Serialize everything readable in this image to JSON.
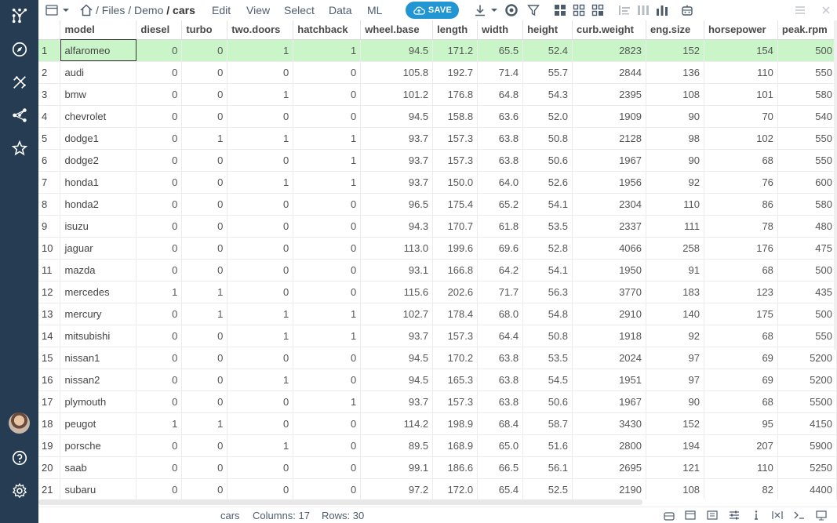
{
  "toolbar": {
    "breadcrumb": {
      "root": "Files",
      "sep": "/",
      "folder": "Demo",
      "current": "cars"
    },
    "menu": [
      "Edit",
      "View",
      "Select",
      "Data",
      "ML"
    ],
    "save_label": "SAVE"
  },
  "table": {
    "columns": [
      "model",
      "diesel",
      "turbo",
      "two.doors",
      "hatchback",
      "wheel.base",
      "length",
      "width",
      "height",
      "curb.weight",
      "eng.size",
      "horsepower",
      "peak.rpm"
    ],
    "rows": [
      [
        "1",
        "alfaromeo",
        "0",
        "0",
        "1",
        "1",
        "94.5",
        "171.2",
        "65.5",
        "52.4",
        "2823",
        "152",
        "154",
        "500"
      ],
      [
        "2",
        "audi",
        "0",
        "0",
        "0",
        "0",
        "105.8",
        "192.7",
        "71.4",
        "55.7",
        "2844",
        "136",
        "110",
        "550"
      ],
      [
        "3",
        "bmw",
        "0",
        "0",
        "1",
        "0",
        "101.2",
        "176.8",
        "64.8",
        "54.3",
        "2395",
        "108",
        "101",
        "580"
      ],
      [
        "4",
        "chevrolet",
        "0",
        "0",
        "0",
        "0",
        "94.5",
        "158.8",
        "63.6",
        "52.0",
        "1909",
        "90",
        "70",
        "540"
      ],
      [
        "5",
        "dodge1",
        "0",
        "1",
        "1",
        "1",
        "93.7",
        "157.3",
        "63.8",
        "50.8",
        "2128",
        "98",
        "102",
        "550"
      ],
      [
        "6",
        "dodge2",
        "0",
        "0",
        "0",
        "1",
        "93.7",
        "157.3",
        "63.8",
        "50.6",
        "1967",
        "90",
        "68",
        "550"
      ],
      [
        "7",
        "honda1",
        "0",
        "0",
        "1",
        "1",
        "93.7",
        "150.0",
        "64.0",
        "52.6",
        "1956",
        "92",
        "76",
        "600"
      ],
      [
        "8",
        "honda2",
        "0",
        "0",
        "0",
        "0",
        "96.5",
        "175.4",
        "65.2",
        "54.1",
        "2304",
        "110",
        "86",
        "580"
      ],
      [
        "9",
        "isuzu",
        "0",
        "0",
        "0",
        "0",
        "94.3",
        "170.7",
        "61.8",
        "53.5",
        "2337",
        "111",
        "78",
        "480"
      ],
      [
        "10",
        "jaguar",
        "0",
        "0",
        "0",
        "0",
        "113.0",
        "199.6",
        "69.6",
        "52.8",
        "4066",
        "258",
        "176",
        "475"
      ],
      [
        "11",
        "mazda",
        "0",
        "0",
        "0",
        "0",
        "93.1",
        "166.8",
        "64.2",
        "54.1",
        "1950",
        "91",
        "68",
        "500"
      ],
      [
        "12",
        "mercedes",
        "1",
        "1",
        "0",
        "0",
        "115.6",
        "202.6",
        "71.7",
        "56.3",
        "3770",
        "183",
        "123",
        "435"
      ],
      [
        "13",
        "mercury",
        "0",
        "1",
        "1",
        "1",
        "102.7",
        "178.4",
        "68.0",
        "54.8",
        "2910",
        "140",
        "175",
        "500"
      ],
      [
        "14",
        "mitsubishi",
        "0",
        "0",
        "1",
        "1",
        "93.7",
        "157.3",
        "64.4",
        "50.8",
        "1918",
        "92",
        "68",
        "550"
      ],
      [
        "15",
        "nissan1",
        "0",
        "0",
        "0",
        "0",
        "94.5",
        "170.2",
        "63.8",
        "53.5",
        "2024",
        "97",
        "69",
        "5200"
      ],
      [
        "16",
        "nissan2",
        "0",
        "0",
        "1",
        "0",
        "94.5",
        "165.3",
        "63.8",
        "54.5",
        "1951",
        "97",
        "69",
        "5200"
      ],
      [
        "17",
        "plymouth",
        "0",
        "0",
        "0",
        "1",
        "93.7",
        "157.3",
        "63.8",
        "50.6",
        "1967",
        "90",
        "68",
        "5500"
      ],
      [
        "18",
        "peugot",
        "1",
        "1",
        "0",
        "0",
        "114.2",
        "198.9",
        "68.4",
        "58.7",
        "3430",
        "152",
        "95",
        "4150"
      ],
      [
        "19",
        "porsche",
        "0",
        "0",
        "1",
        "0",
        "89.5",
        "168.9",
        "65.0",
        "51.6",
        "2800",
        "194",
        "207",
        "5900"
      ],
      [
        "20",
        "saab",
        "0",
        "0",
        "0",
        "0",
        "99.1",
        "186.6",
        "66.5",
        "56.1",
        "2695",
        "121",
        "110",
        "5250"
      ],
      [
        "21",
        "subaru",
        "0",
        "0",
        "0",
        "0",
        "97.2",
        "172.0",
        "65.4",
        "52.5",
        "2190",
        "108",
        "82",
        "4400"
      ]
    ]
  },
  "status": {
    "name": "cars",
    "columns": "Columns: 17",
    "rows": "Rows: 30"
  },
  "colors": {
    "sidebar": "#263c52",
    "accent": "#2196d3",
    "selected_row": "#c9f5c9"
  },
  "icons": {
    "sidebar": [
      "app-logo-icon",
      "browse-icon",
      "functions-icon",
      "network-icon",
      "favorites-icon",
      "help-icon",
      "settings-icon"
    ]
  }
}
